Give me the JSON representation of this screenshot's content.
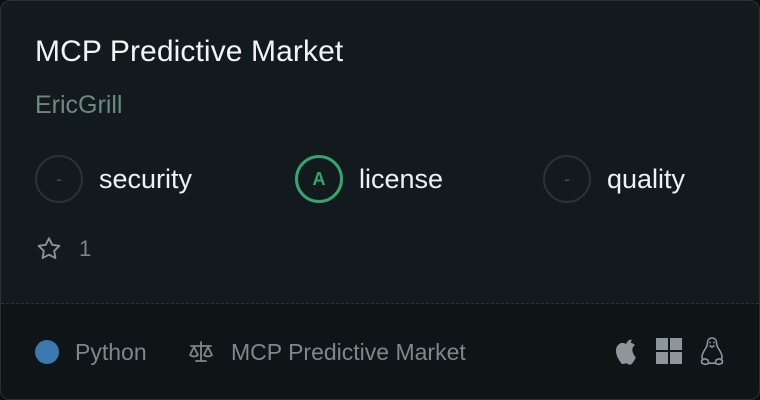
{
  "title": "MCP Predictive Market",
  "author": "EricGrill",
  "scores": [
    {
      "grade": "-",
      "label": "security"
    },
    {
      "grade": "A",
      "label": "license"
    },
    {
      "grade": "-",
      "label": "quality"
    }
  ],
  "stars": {
    "count": "1",
    "icon": "star-outline-icon"
  },
  "footer": {
    "language": {
      "name": "Python",
      "color": "#3a78ad"
    },
    "license": {
      "name": "MCP Predictive Market",
      "icon": "scale-icon"
    },
    "platforms": [
      "apple-icon",
      "windows-icon",
      "linux-icon"
    ]
  },
  "colors": {
    "accent_green": "#34a56f",
    "background": "#131a1d"
  }
}
